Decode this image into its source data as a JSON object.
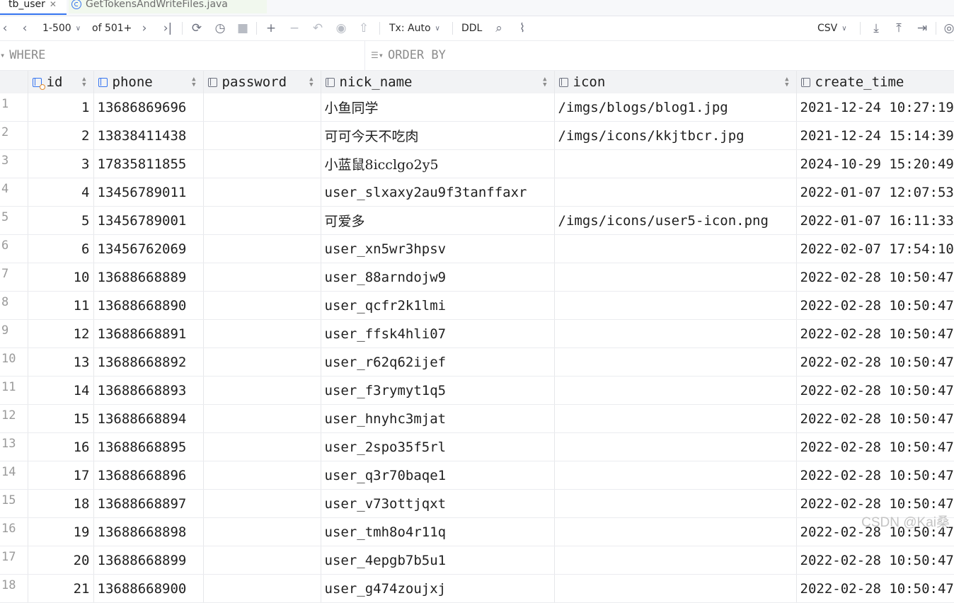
{
  "tabs": [
    {
      "label": "tb_user",
      "active": true
    },
    {
      "label": "GetTokensAndWriteFiles.java",
      "active": false
    }
  ],
  "toolbar": {
    "page_range": "1-500",
    "of_total": "of 501+",
    "tx_mode": "Tx: Auto",
    "ddl_label": "DDL",
    "export_format": "CSV",
    "icons": [
      "first-page-icon",
      "prev-page-icon",
      "next-page-icon",
      "last-page-icon",
      "reload-icon",
      "history-icon",
      "stop-icon",
      "add-row-icon",
      "delete-row-icon",
      "revert-icon",
      "preview-icon",
      "submit-icon",
      "search-icon",
      "chart-icon",
      "download-icon",
      "upload-icon",
      "compare-icon",
      "view-icon"
    ]
  },
  "filter": {
    "where_label": "WHERE",
    "order_by_label": "ORDER BY"
  },
  "grid": {
    "columns": [
      "id",
      "phone",
      "password",
      "nick_name",
      "icon",
      "create_time"
    ],
    "rows": [
      {
        "n": "1",
        "id": "1",
        "phone": "13686869696",
        "password": "",
        "nick_name": "小鱼同学",
        "icon": "/imgs/blogs/blog1.jpg",
        "create_time": "2021-12-24 10:27:19"
      },
      {
        "n": "2",
        "id": "2",
        "phone": "13838411438",
        "password": "",
        "nick_name": "可可今天不吃肉",
        "icon": "/imgs/icons/kkjtbcr.jpg",
        "create_time": "2021-12-24 15:14:39"
      },
      {
        "n": "3",
        "id": "3",
        "phone": "17835811855",
        "password": "",
        "nick_name": "小蓝鼠8icclgo2y5",
        "icon": "",
        "create_time": "2024-10-29 15:20:49"
      },
      {
        "n": "4",
        "id": "4",
        "phone": "13456789011",
        "password": "",
        "nick_name": "user_slxaxy2au9f3tanffaxr",
        "icon": "",
        "create_time": "2022-01-07 12:07:53"
      },
      {
        "n": "5",
        "id": "5",
        "phone": "13456789001",
        "password": "",
        "nick_name": "可爱多",
        "icon": "/imgs/icons/user5-icon.png",
        "create_time": "2022-01-07 16:11:33"
      },
      {
        "n": "6",
        "id": "6",
        "phone": "13456762069",
        "password": "",
        "nick_name": "user_xn5wr3hpsv",
        "icon": "",
        "create_time": "2022-02-07 17:54:10"
      },
      {
        "n": "7",
        "id": "10",
        "phone": "13688668889",
        "password": "",
        "nick_name": "user_88arndojw9",
        "icon": "",
        "create_time": "2022-02-28 10:50:47"
      },
      {
        "n": "8",
        "id": "11",
        "phone": "13688668890",
        "password": "",
        "nick_name": "user_qcfr2k1lmi",
        "icon": "",
        "create_time": "2022-02-28 10:50:47"
      },
      {
        "n": "9",
        "id": "12",
        "phone": "13688668891",
        "password": "",
        "nick_name": "user_ffsk4hli07",
        "icon": "",
        "create_time": "2022-02-28 10:50:47"
      },
      {
        "n": "10",
        "id": "13",
        "phone": "13688668892",
        "password": "",
        "nick_name": "user_r62q62ijef",
        "icon": "",
        "create_time": "2022-02-28 10:50:47"
      },
      {
        "n": "11",
        "id": "14",
        "phone": "13688668893",
        "password": "",
        "nick_name": "user_f3rymyt1q5",
        "icon": "",
        "create_time": "2022-02-28 10:50:47"
      },
      {
        "n": "12",
        "id": "15",
        "phone": "13688668894",
        "password": "",
        "nick_name": "user_hnyhc3mjat",
        "icon": "",
        "create_time": "2022-02-28 10:50:47"
      },
      {
        "n": "13",
        "id": "16",
        "phone": "13688668895",
        "password": "",
        "nick_name": "user_2spo35f5rl",
        "icon": "",
        "create_time": "2022-02-28 10:50:47"
      },
      {
        "n": "14",
        "id": "17",
        "phone": "13688668896",
        "password": "",
        "nick_name": "user_q3r70baqe1",
        "icon": "",
        "create_time": "2022-02-28 10:50:47"
      },
      {
        "n": "15",
        "id": "18",
        "phone": "13688668897",
        "password": "",
        "nick_name": "user_v73ottjqxt",
        "icon": "",
        "create_time": "2022-02-28 10:50:47"
      },
      {
        "n": "16",
        "id": "19",
        "phone": "13688668898",
        "password": "",
        "nick_name": "user_tmh8o4r11q",
        "icon": "",
        "create_time": "2022-02-28 10:50:47"
      },
      {
        "n": "17",
        "id": "20",
        "phone": "13688668899",
        "password": "",
        "nick_name": "user_4epgb7b5u1",
        "icon": "",
        "create_time": "2022-02-28 10:50:47"
      },
      {
        "n": "18",
        "id": "21",
        "phone": "13688668900",
        "password": "",
        "nick_name": "user_g474zoujxj",
        "icon": "",
        "create_time": "2022-02-28 10:50:47"
      }
    ]
  },
  "watermark": "CSDN @Kai桑"
}
